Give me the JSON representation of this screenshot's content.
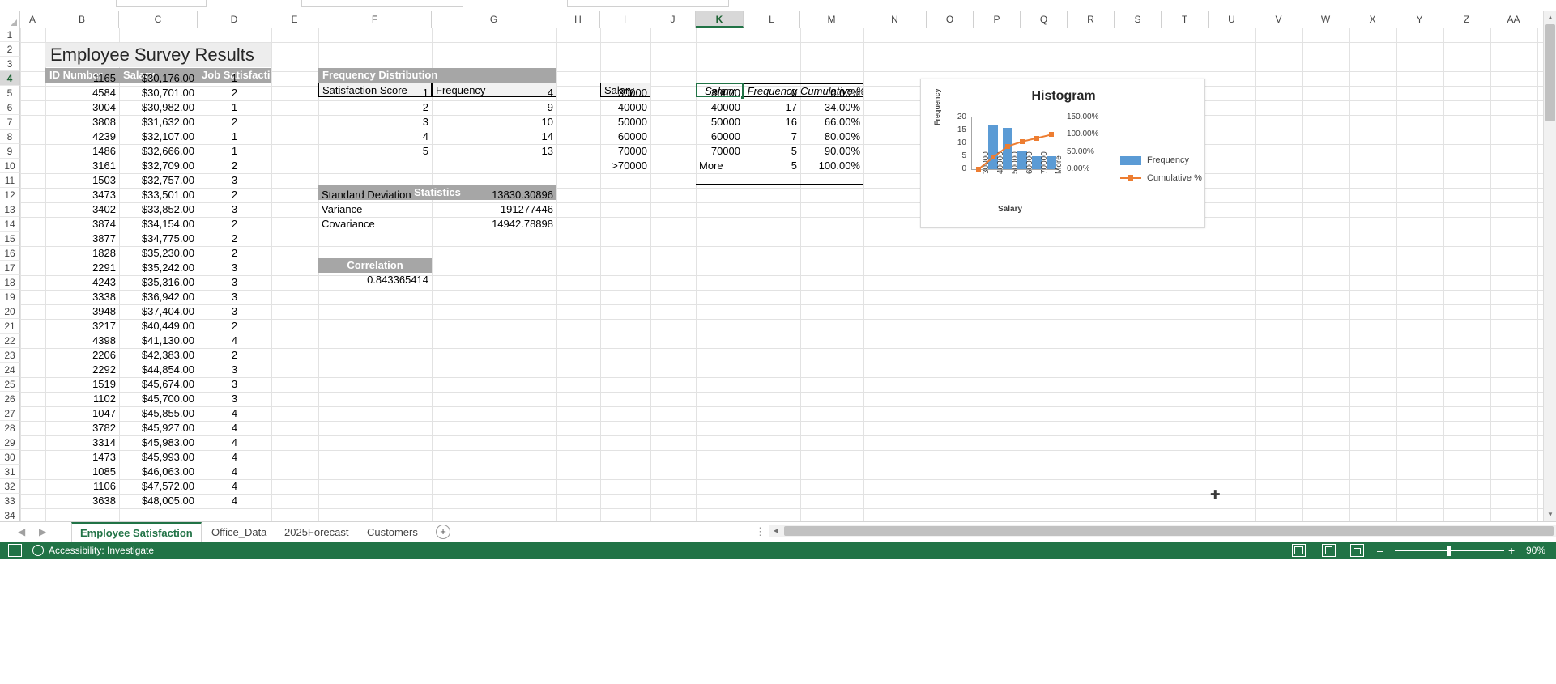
{
  "grid": {
    "columns": [
      "A",
      "B",
      "C",
      "D",
      "E",
      "F",
      "G",
      "H",
      "I",
      "J",
      "K",
      "L",
      "M",
      "N",
      "O",
      "P",
      "Q",
      "R",
      "S",
      "T",
      "U"
    ],
    "selected_column": "K",
    "rows": [
      "1",
      "2",
      "3",
      "4",
      "5",
      "6",
      "7",
      "8",
      "9",
      "10",
      "11",
      "12",
      "13",
      "14",
      "15",
      "16",
      "17",
      "18",
      "19",
      "20",
      "21",
      "22",
      "23",
      "24",
      "25",
      "26",
      "27",
      "28",
      "29",
      "30",
      "31",
      "32",
      "33"
    ],
    "selected_row": "4"
  },
  "sheet": {
    "title": "Employee Survey Results",
    "table_headers": {
      "id": "ID Number",
      "salary": "Salary",
      "satisfaction": "Job Satisfaction"
    },
    "employees": [
      {
        "row": "4",
        "id": "1165",
        "salary": "$30,176.00",
        "sat": "1"
      },
      {
        "row": "5",
        "id": "4584",
        "salary": "$30,701.00",
        "sat": "2"
      },
      {
        "row": "6",
        "id": "3004",
        "salary": "$30,982.00",
        "sat": "1"
      },
      {
        "row": "7",
        "id": "3808",
        "salary": "$31,632.00",
        "sat": "2"
      },
      {
        "row": "8",
        "id": "4239",
        "salary": "$32,107.00",
        "sat": "1"
      },
      {
        "row": "9",
        "id": "1486",
        "salary": "$32,666.00",
        "sat": "1"
      },
      {
        "row": "10",
        "id": "3161",
        "salary": "$32,709.00",
        "sat": "2"
      },
      {
        "row": "11",
        "id": "1503",
        "salary": "$32,757.00",
        "sat": "3"
      },
      {
        "row": "12",
        "id": "3473",
        "salary": "$33,501.00",
        "sat": "2"
      },
      {
        "row": "13",
        "id": "3402",
        "salary": "$33,852.00",
        "sat": "3"
      },
      {
        "row": "14",
        "id": "3874",
        "salary": "$34,154.00",
        "sat": "2"
      },
      {
        "row": "15",
        "id": "3877",
        "salary": "$34,775.00",
        "sat": "2"
      },
      {
        "row": "16",
        "id": "1828",
        "salary": "$35,230.00",
        "sat": "2"
      },
      {
        "row": "17",
        "id": "2291",
        "salary": "$35,242.00",
        "sat": "3"
      },
      {
        "row": "18",
        "id": "4243",
        "salary": "$35,316.00",
        "sat": "3"
      },
      {
        "row": "19",
        "id": "3338",
        "salary": "$36,942.00",
        "sat": "3"
      },
      {
        "row": "20",
        "id": "3948",
        "salary": "$37,404.00",
        "sat": "3"
      },
      {
        "row": "21",
        "id": "3217",
        "salary": "$40,449.00",
        "sat": "2"
      },
      {
        "row": "22",
        "id": "4398",
        "salary": "$41,130.00",
        "sat": "4"
      },
      {
        "row": "23",
        "id": "2206",
        "salary": "$42,383.00",
        "sat": "2"
      },
      {
        "row": "24",
        "id": "2292",
        "salary": "$44,854.00",
        "sat": "3"
      },
      {
        "row": "25",
        "id": "1519",
        "salary": "$45,674.00",
        "sat": "3"
      },
      {
        "row": "26",
        "id": "1102",
        "salary": "$45,700.00",
        "sat": "3"
      },
      {
        "row": "27",
        "id": "1047",
        "salary": "$45,855.00",
        "sat": "4"
      },
      {
        "row": "28",
        "id": "3782",
        "salary": "$45,927.00",
        "sat": "4"
      },
      {
        "row": "29",
        "id": "3314",
        "salary": "$45,983.00",
        "sat": "4"
      },
      {
        "row": "30",
        "id": "1473",
        "salary": "$45,993.00",
        "sat": "4"
      },
      {
        "row": "31",
        "id": "1085",
        "salary": "$46,063.00",
        "sat": "4"
      },
      {
        "row": "32",
        "id": "1106",
        "salary": "$47,572.00",
        "sat": "4"
      },
      {
        "row": "33",
        "id": "3638",
        "salary": "$48,005.00",
        "sat": "4"
      }
    ],
    "frequency_distribution": {
      "band_title": "Frequency Distribution",
      "col_score": "Satisfaction Score",
      "col_freq": "Frequency",
      "rows": [
        {
          "score": "1",
          "freq": "4"
        },
        {
          "score": "2",
          "freq": "9"
        },
        {
          "score": "3",
          "freq": "10"
        },
        {
          "score": "4",
          "freq": "14"
        },
        {
          "score": "5",
          "freq": "13"
        }
      ]
    },
    "statistics": {
      "band_title": "Statistics",
      "rows": [
        {
          "label": "Standard Deviation",
          "value": "13830.30896"
        },
        {
          "label": "Variance",
          "value": "191277446"
        },
        {
          "label": "Covariance",
          "value": "14942.78898"
        }
      ]
    },
    "correlation": {
      "band_title": "Correlation",
      "value": "0.843365414"
    },
    "bins": {
      "header": "Salary",
      "values": [
        "30000",
        "40000",
        "50000",
        "60000",
        "70000",
        ">70000"
      ]
    },
    "histogram_table": {
      "headers": {
        "salary": "Salary",
        "frequency": "Frequency",
        "cumulative": "Cumulative %"
      },
      "rows": [
        {
          "salary": "30000",
          "freq": "0",
          "cum": "0.00%"
        },
        {
          "salary": "40000",
          "freq": "17",
          "cum": "34.00%"
        },
        {
          "salary": "50000",
          "freq": "16",
          "cum": "66.00%"
        },
        {
          "salary": "60000",
          "freq": "7",
          "cum": "80.00%"
        },
        {
          "salary": "70000",
          "freq": "5",
          "cum": "90.00%"
        },
        {
          "salary": "More",
          "freq": "5",
          "cum": "100.00%"
        }
      ]
    }
  },
  "chart_data": {
    "type": "bar",
    "title": "Histogram",
    "xlabel": "Salary",
    "ylabel": "Frequency",
    "categories": [
      "30000",
      "40000",
      "50000",
      "60000",
      "70000",
      "More"
    ],
    "series": [
      {
        "name": "Frequency",
        "type": "bar",
        "values": [
          0,
          17,
          16,
          7,
          5,
          5
        ],
        "color": "#5b9bd5"
      },
      {
        "name": "Cumulative %",
        "type": "line",
        "values": [
          0,
          34,
          66,
          80,
          90,
          100
        ],
        "color": "#ed7d31"
      }
    ],
    "y_ticks": [
      "20",
      "15",
      "10",
      "5",
      "0"
    ],
    "ylim": [
      0,
      20
    ],
    "y2_ticks": [
      "150.00%",
      "100.00%",
      "50.00%",
      "0.00%"
    ],
    "y2lim": [
      0,
      150
    ],
    "grid": false,
    "legend_position": "right",
    "legend": [
      "Frequency",
      "Cumulative %"
    ]
  },
  "tabs": {
    "items": [
      {
        "label": "Employee Satisfaction",
        "active": true
      },
      {
        "label": "Office_Data",
        "active": false
      },
      {
        "label": "2025Forecast",
        "active": false
      },
      {
        "label": "Customers",
        "active": false
      }
    ],
    "add_label": "+",
    "prev_icon": "chevron-left-icon",
    "next_icon": "chevron-right-icon"
  },
  "status": {
    "accessibility": "Accessibility: Investigate",
    "zoom": "90%",
    "zoom_out": "–",
    "zoom_in": "+",
    "view_normal": "normal-view-icon",
    "view_layout": "page-layout-icon",
    "view_break": "page-break-icon",
    "macro_icon": "record-macro-icon"
  },
  "colors": {
    "accent_green": "#217346",
    "band_gray": "#a6a6a6",
    "bar_blue": "#5b9bd5",
    "line_orange": "#ed7d31"
  }
}
